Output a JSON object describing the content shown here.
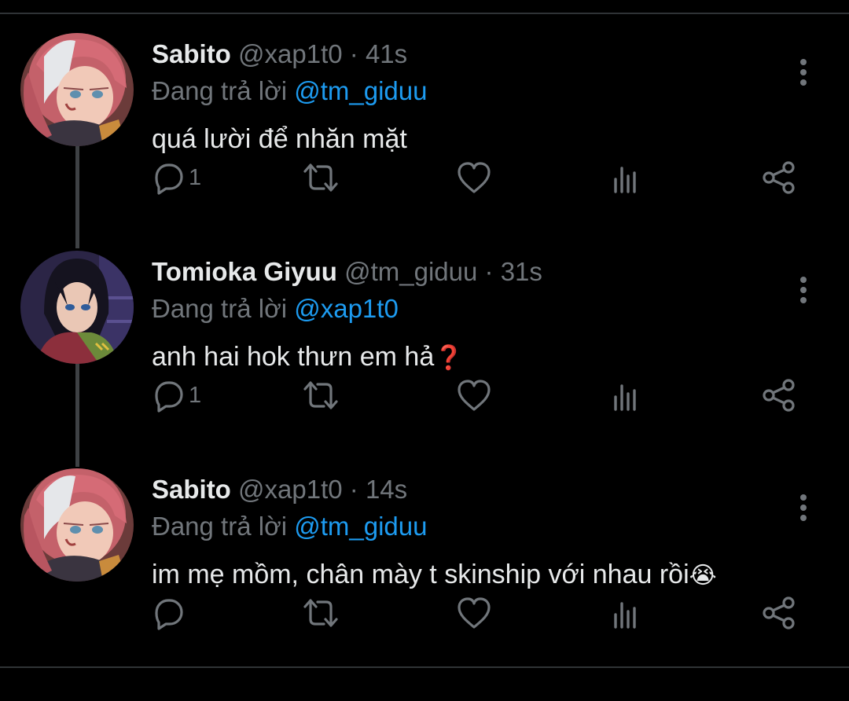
{
  "colors": {
    "background": "#000000",
    "text": "#e7e9ea",
    "muted": "#71767b",
    "mention": "#1d9bf0",
    "divider": "#2f3336"
  },
  "reply_prefix": "Đang trả lời",
  "tweets": [
    {
      "display_name": "Sabito",
      "handle": "@xap1t0",
      "separator": "·",
      "time": "41s",
      "reply_to": "@tm_giduu",
      "text": "quá lười để nhăn mặt",
      "emoji": "",
      "reply_count": "1",
      "avatar": "sabito-avatar"
    },
    {
      "display_name": "Tomioka Giyuu",
      "handle": "@tm_giduu",
      "separator": "·",
      "time": "31s",
      "reply_to": "@xap1t0",
      "text": "anh hai hok thưn em hả",
      "emoji": "❓",
      "reply_count": "1",
      "avatar": "giyuu-avatar"
    },
    {
      "display_name": "Sabito",
      "handle": "@xap1t0",
      "separator": "·",
      "time": "14s",
      "reply_to": "@tm_giduu",
      "text": "im mẹ mồm, chân mày t skinship với nhau rồi",
      "emoji": "😭",
      "reply_count": "",
      "avatar": "sabito-avatar"
    }
  ],
  "icons": [
    "reply-icon",
    "retweet-icon",
    "like-icon",
    "analytics-icon",
    "share-icon",
    "more-options-icon"
  ]
}
